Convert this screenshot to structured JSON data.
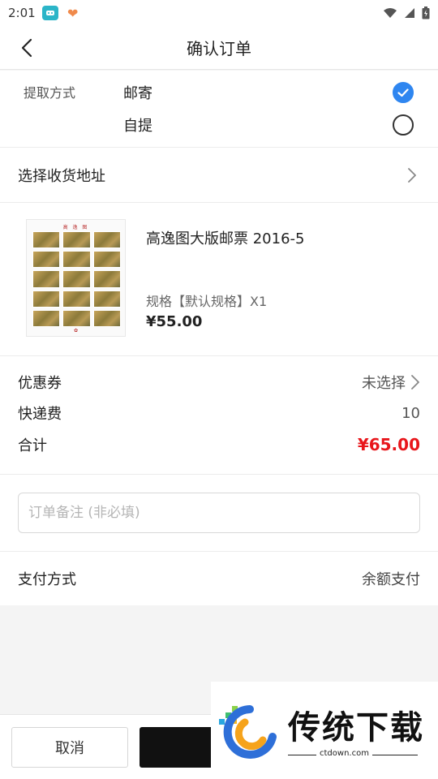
{
  "status_bar": {
    "time": "2:01"
  },
  "header": {
    "title": "确认订单"
  },
  "delivery": {
    "label": "提取方式",
    "options": [
      {
        "label": "邮寄",
        "selected": true
      },
      {
        "label": "自提",
        "selected": false
      }
    ]
  },
  "address": {
    "label": "选择收货地址"
  },
  "product": {
    "stamp_header": "高 逸 图",
    "name": "高逸图大版邮票 2016-5",
    "spec": "规格【默认规格】X1",
    "price": "¥55.00"
  },
  "costs": {
    "coupon_label": "优惠券",
    "coupon_value": "未选择",
    "shipping_label": "快递费",
    "shipping_value": "10",
    "total_label": "合计",
    "total_value": "¥65.00"
  },
  "remark": {
    "placeholder": "订单备注 (非必填)"
  },
  "payment": {
    "label": "支付方式",
    "value": "余额支付"
  },
  "bottom_bar": {
    "cancel_label": "取消"
  },
  "watermark": {
    "brand": "传统下载",
    "url": "ctdown.com"
  },
  "colors": {
    "accent": "#2f86f0",
    "price_red": "#e8161b",
    "confirm_button": "#111111"
  }
}
